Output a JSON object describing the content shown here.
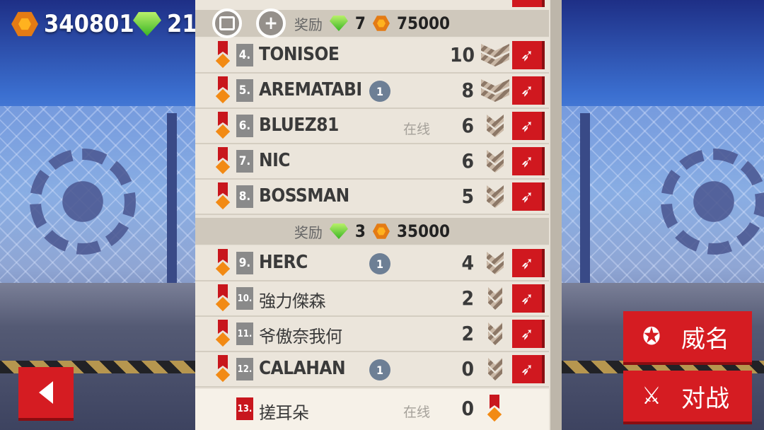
{
  "currency": {
    "coins": "340801",
    "gems": "21"
  },
  "rewards": [
    {
      "label": "奖励",
      "gems": "7",
      "coins": "75000"
    },
    {
      "label": "奖励",
      "gems": "3",
      "coins": "35000"
    }
  ],
  "players": [
    {
      "rank": "4.",
      "name": "TONISOE",
      "badge": "",
      "online": "",
      "score": "10"
    },
    {
      "rank": "5.",
      "name": "AREMATABI",
      "badge": "1",
      "online": "",
      "score": "8"
    },
    {
      "rank": "6.",
      "name": "BLUEZ81",
      "badge": "",
      "online": "在线",
      "score": "6"
    },
    {
      "rank": "7.",
      "name": "NIC",
      "badge": "",
      "online": "",
      "score": "6"
    },
    {
      "rank": "8.",
      "name": "BOSSMAN",
      "badge": "",
      "online": "",
      "score": "5"
    },
    {
      "rank": "9.",
      "name": "HERC",
      "badge": "1",
      "online": "",
      "score": "4"
    },
    {
      "rank": "10.",
      "name": "強力傑森",
      "badge": "",
      "online": "",
      "score": "2"
    },
    {
      "rank": "11.",
      "name": "爷傲奈我何",
      "badge": "",
      "online": "",
      "score": "2"
    },
    {
      "rank": "12.",
      "name": "CALAHAN",
      "badge": "1",
      "online": "",
      "score": "0"
    },
    {
      "rank": "13.",
      "name": "搓耳朵",
      "badge": "",
      "online": "在线",
      "score": "0"
    }
  ],
  "buttons": {
    "fame": "威名",
    "battle": "对战"
  },
  "icons": {
    "coin": "hexagon-coin-icon",
    "gem": "green-gem-icon",
    "chest": "chest-icon",
    "add": "plus-icon",
    "back": "back-arrow-icon",
    "fight": "sword-icon"
  }
}
